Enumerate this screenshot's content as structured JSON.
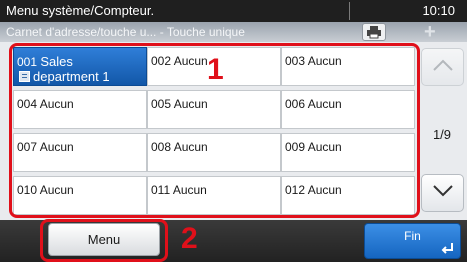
{
  "status_bar": {
    "title": "Menu système/Compteur.",
    "clock": "10:10"
  },
  "sub_header": {
    "title": "Carnet d'adresse/touche u...  - Touche unique"
  },
  "grid": {
    "cells": [
      {
        "num": "001",
        "name": "Sales",
        "line2": "department 1",
        "selected": true
      },
      {
        "num": "002",
        "name": "Aucun"
      },
      {
        "num": "003",
        "name": "Aucun"
      },
      {
        "num": "004",
        "name": "Aucun"
      },
      {
        "num": "005",
        "name": "Aucun"
      },
      {
        "num": "006",
        "name": "Aucun"
      },
      {
        "num": "007",
        "name": "Aucun"
      },
      {
        "num": "008",
        "name": "Aucun"
      },
      {
        "num": "009",
        "name": "Aucun"
      },
      {
        "num": "010",
        "name": "Aucun"
      },
      {
        "num": "011",
        "name": "Aucun"
      },
      {
        "num": "012",
        "name": "Aucun"
      }
    ]
  },
  "pagination": {
    "indicator": "1/9"
  },
  "bottom_bar": {
    "menu_label": "Menu",
    "end_label": "Fin"
  },
  "annotations": {
    "label_1": "1",
    "label_2": "2"
  },
  "colors": {
    "accent": "#1565c0",
    "highlight_red": "#e0101a",
    "status_bar_bg": "#1f1f1f"
  }
}
